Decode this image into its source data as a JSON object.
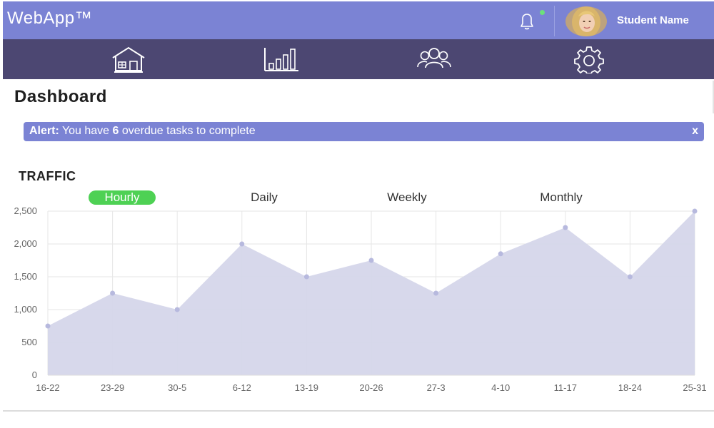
{
  "app": {
    "brand": "WebApp™",
    "user_name": "Student Name",
    "accent": "#7b83d4",
    "nav_bg": "#4c4772"
  },
  "nav": {
    "items": [
      {
        "icon": "home-icon"
      },
      {
        "icon": "bar-chart-icon"
      },
      {
        "icon": "users-icon"
      },
      {
        "icon": "settings-gear-icon"
      }
    ]
  },
  "main": {
    "title": "Dashboard",
    "alert": {
      "label": "Alert:",
      "text_before": " You have ",
      "count": "6",
      "text_after": " overdue tasks to complete",
      "close": "x"
    },
    "section_title": "TRAFFIC",
    "tabs": [
      "Hourly",
      "Daily",
      "Weekly",
      "Monthly"
    ],
    "active_tab": "Hourly"
  },
  "chart_data": {
    "type": "area",
    "x": [
      "16-22",
      "23-29",
      "30-5",
      "6-12",
      "13-19",
      "20-26",
      "27-3",
      "4-10",
      "11-17",
      "18-24",
      "25-31"
    ],
    "series": [
      {
        "values": [
          750,
          1250,
          1000,
          2000,
          1500,
          1750,
          1250,
          1850,
          2250,
          1500,
          2500
        ]
      }
    ],
    "yticks": [
      "0",
      "500",
      "1,000",
      "1,500",
      "2,000",
      "2,500"
    ],
    "ylim": [
      0,
      2500
    ],
    "grid": true,
    "fill_color": "#d5d6ea",
    "point_color": "#b7b9de"
  }
}
